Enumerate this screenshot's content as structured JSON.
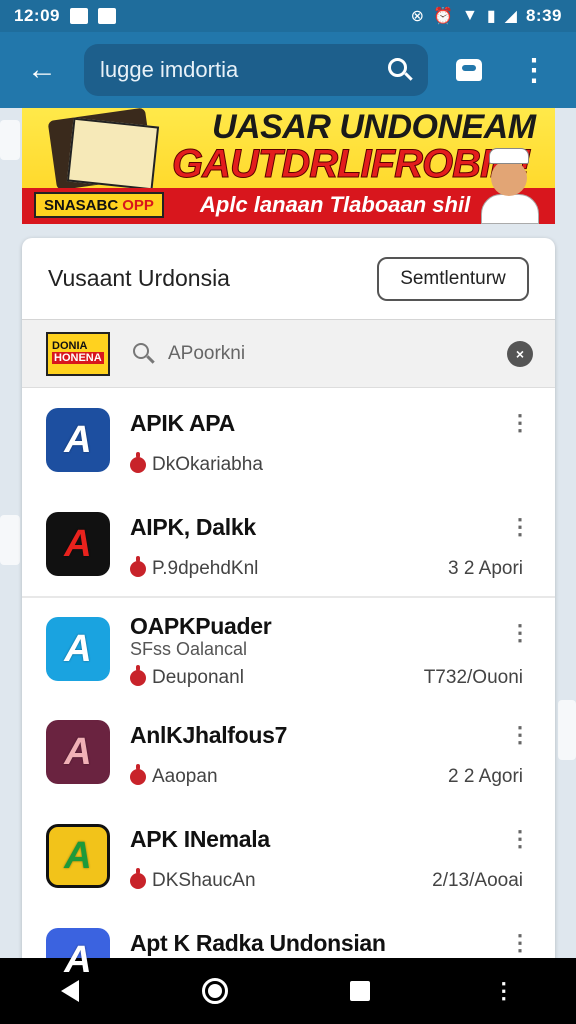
{
  "status_bar": {
    "time": "12:09",
    "clock": "8:39"
  },
  "app_bar": {
    "search_text": "lugge imdortia"
  },
  "banner": {
    "title_line1": "UASAR UNDONEAM",
    "title_line2": "GAUTDRLIFROBIN!",
    "strip_text": "Aplc lanaan Tlaboaan shil",
    "badge_text": "SNASABC",
    "badge_accent": "OPP"
  },
  "card": {
    "title": "Vusaant Urdonsia",
    "button_label": "Semtlenturw",
    "filter_logo_line1": "DONIA",
    "filter_logo_line2": "HONENA",
    "search_placeholder": "APoorkni"
  },
  "apps": [
    {
      "name": "APIK APA",
      "subtitle": "",
      "developer": "DkOkariabha",
      "meta": "",
      "icon_color": "#1d4fa0",
      "icon_mark": "A"
    },
    {
      "name": "AIPK, Dalkk",
      "subtitle": "",
      "developer": "P.9dpehdKnl",
      "meta": "3 2 Apori",
      "icon_color": "#111111",
      "icon_mark": "A"
    },
    {
      "name": "OAPKPuader",
      "subtitle": "SFss Oalancal",
      "developer": "Deuponanl",
      "meta": "T732/Ouoni",
      "icon_color": "#1aa3e0",
      "icon_mark": "A"
    },
    {
      "name": "AnlKJhalfous7",
      "subtitle": "",
      "developer": "Aaopan",
      "meta": "2 2 Agori",
      "icon_color": "#6a2340",
      "icon_mark": "A"
    },
    {
      "name": "APK INemala",
      "subtitle": "",
      "developer": "DKShaucAn",
      "meta": "2/13/Aooai",
      "icon_color": "#f2c31a",
      "icon_mark": "A"
    },
    {
      "name": "Apt K Radka Undonsian",
      "subtitle": "",
      "developer": "",
      "meta": "",
      "icon_color": "#3b63e0",
      "icon_mark": "A"
    }
  ],
  "colors": {
    "primary": "#2277ab",
    "primary_dark": "#1f6d9c",
    "accent_red": "#d8161d",
    "accent_yellow": "#ffd21f"
  }
}
